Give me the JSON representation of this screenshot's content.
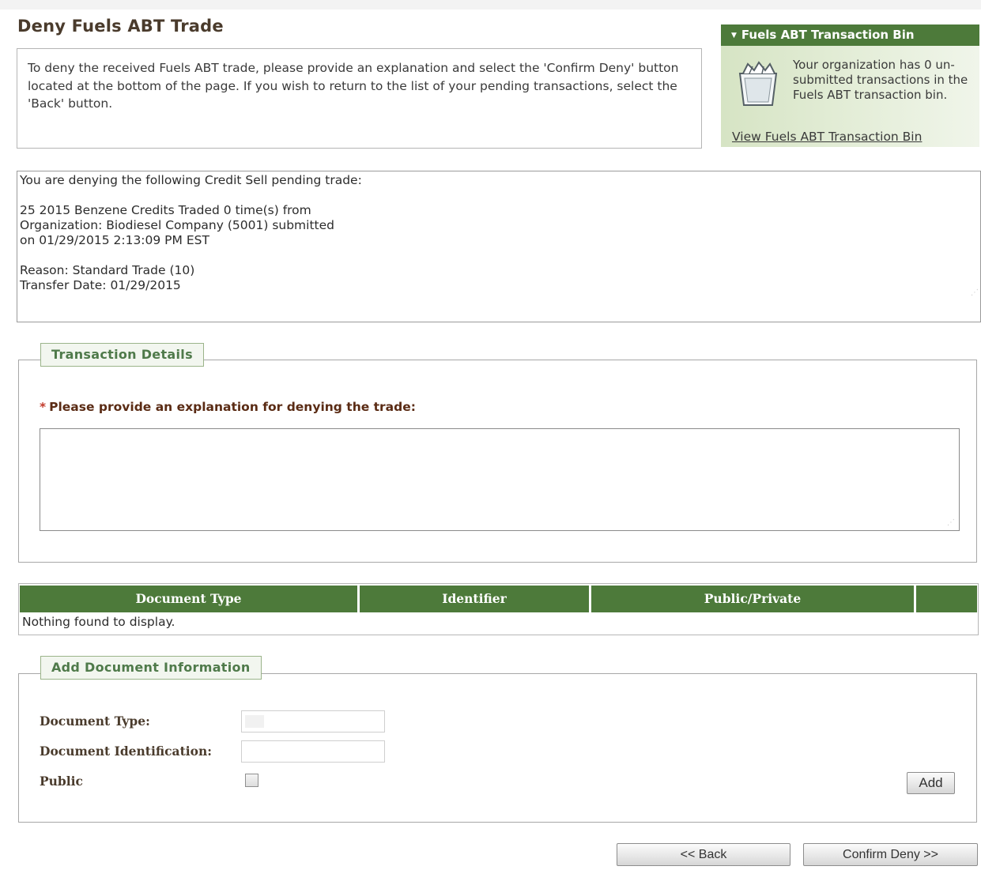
{
  "page": {
    "title": "Deny Fuels ABT Trade",
    "intro": "To deny the received Fuels ABT trade, please provide an explanation and select the 'Confirm Deny' button located at the bottom of the page. If you wish to return to the list of your pending transactions, select the 'Back' button."
  },
  "bin": {
    "header": "Fuels ABT Transaction Bin",
    "message": "Your organization has 0 un-submitted transactions in the Fuels ABT transaction bin.",
    "link": "View Fuels ABT Transaction Bin",
    "icon": "basket-icon"
  },
  "trade": {
    "heading": "You are denying the following Credit Sell pending trade:",
    "line1": "25 2015 Benzene Credits Traded 0 time(s) from",
    "line2": "Organization: Biodiesel Company (5001) submitted",
    "line3": "on 01/29/2015 2:13:09 PM EST",
    "reason": "Reason: Standard Trade (10)",
    "transfer_date": "Transfer Date: 01/29/2015"
  },
  "transaction_details": {
    "legend": "Transaction Details",
    "required_mark": "*",
    "explanation_label": "Please provide an explanation for denying the trade:",
    "explanation_value": ""
  },
  "documents": {
    "columns": [
      "Document Type",
      "Identifier",
      "Public/Private",
      ""
    ],
    "empty_message": "Nothing found to display."
  },
  "add_document": {
    "legend": "Add Document Information",
    "type_label": "Document Type:",
    "type_value": "",
    "id_label": "Document Identification:",
    "id_value": "",
    "public_label": "Public",
    "public_checked": false,
    "add_button": "Add"
  },
  "actions": {
    "back": "<< Back",
    "confirm": "Confirm Deny >>"
  },
  "colors": {
    "header_green": "#4d7a3a",
    "title_brown": "#4a3b2c",
    "required_red": "#c23b2c"
  }
}
